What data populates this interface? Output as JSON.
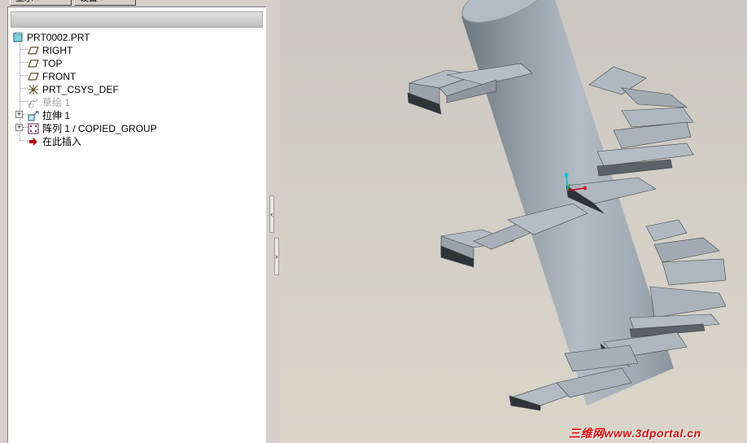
{
  "toolbar": {
    "display_label": "显示",
    "settings_label": "设置"
  },
  "model_tree": {
    "items": [
      {
        "label": "PRT0002.PRT",
        "icon": "part-icon"
      },
      {
        "label": "RIGHT",
        "icon": "datum-plane-icon"
      },
      {
        "label": "TOP",
        "icon": "datum-plane-icon"
      },
      {
        "label": "FRONT",
        "icon": "datum-plane-icon"
      },
      {
        "label": "PRT_CSYS_DEF",
        "icon": "coordinate-system-icon"
      },
      {
        "label": "草绘 1",
        "icon": "sketch-icon"
      },
      {
        "label": "拉伸 1",
        "icon": "extrude-icon"
      },
      {
        "label": "阵列 1 / COPIED_GROUP",
        "icon": "pattern-icon"
      },
      {
        "label": "在此插入",
        "icon": "insert-here-arrow-icon"
      }
    ]
  },
  "viewport": {
    "watermark": "三维网www.3dportal.cn",
    "model_color": "#9ea8b1",
    "background_color": "#d2cfc6"
  },
  "colors": {
    "insert_arrow": "#c00000",
    "watermark": "#e00000"
  }
}
